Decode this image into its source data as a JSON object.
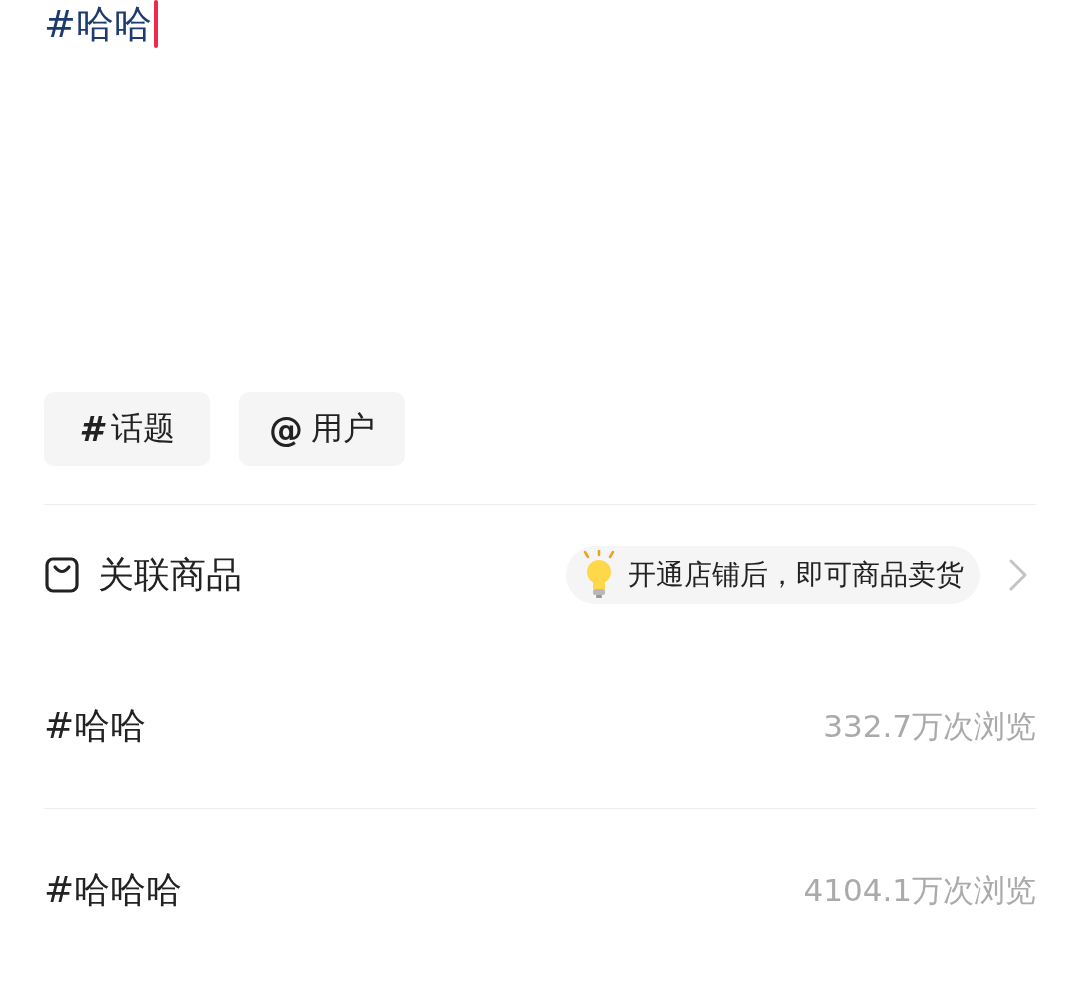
{
  "editor": {
    "value": "#哈哈"
  },
  "insert_buttons": [
    {
      "symbol": "#",
      "label": "话题"
    },
    {
      "symbol": "@",
      "label": "用户"
    }
  ],
  "product_link": {
    "label": "关联商品",
    "hint": "开通店铺后，即可商品卖货"
  },
  "topic_suggestions": [
    {
      "name": "#哈哈",
      "views": "332.7万次浏览"
    },
    {
      "name": "#哈哈哈",
      "views": "4104.1万次浏览"
    }
  ]
}
